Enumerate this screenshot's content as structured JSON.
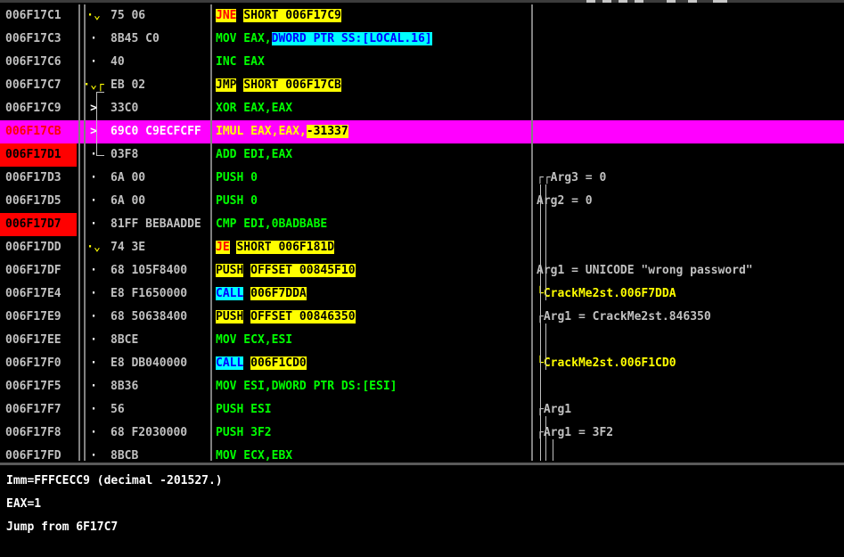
{
  "rows": [
    {
      "addr": "006F17C1",
      "addr_red": false,
      "mark": "·⌄",
      "bytes": "75 06",
      "parts": [
        {
          "t": "JNE",
          "c": "hl-r"
        },
        {
          "t": " "
        },
        {
          "t": "SHORT 006F17C9",
          "c": "hl-y"
        }
      ],
      "comment": []
    },
    {
      "addr": "006F17C3",
      "addr_red": false,
      "mark": "·",
      "bytes": "8B45 C0",
      "parts": [
        {
          "t": "MOV EAX,"
        },
        {
          "t": "DWORD PTR SS:[LOCAL.16]",
          "c": "hl-c"
        }
      ],
      "comment": []
    },
    {
      "addr": "006F17C6",
      "addr_red": false,
      "mark": "·",
      "bytes": "40",
      "parts": [
        {
          "t": "INC EAX"
        }
      ],
      "comment": []
    },
    {
      "addr": "006F17C7",
      "addr_red": false,
      "mark": "·⌄┌",
      "bytes": "EB 02",
      "parts": [
        {
          "t": "JMP",
          "c": "hl-y"
        },
        {
          "t": " "
        },
        {
          "t": "SHORT 006F17CB",
          "c": "hl-y"
        }
      ],
      "comment": []
    },
    {
      "addr": "006F17C9",
      "addr_red": false,
      "mark": ">",
      "bytes": "33C0",
      "parts": [
        {
          "t": "XOR EAX,EAX"
        }
      ],
      "comment": []
    },
    {
      "addr": "006F17CB",
      "addr_red": false,
      "selected": true,
      "mark": ">",
      "bytes": "69C0 C9ECFCFF",
      "parts": [
        {
          "t": "IMUL EAX,EAX,"
        },
        {
          "t": "-31337",
          "c": "hl-yy"
        }
      ],
      "comment": []
    },
    {
      "addr": "006F17D1",
      "addr_red": true,
      "mark": "·",
      "bytes": "03F8",
      "parts": [
        {
          "t": "ADD EDI,EAX"
        }
      ],
      "comment": []
    },
    {
      "addr": "006F17D3",
      "addr_red": false,
      "mark": "·",
      "bytes": "6A 00",
      "parts": [
        {
          "t": "PUSH 0"
        }
      ],
      "comment": [
        {
          "t": "┌┌",
          "c": "w"
        },
        {
          "t": "Arg3 = 0",
          "c": "w"
        }
      ]
    },
    {
      "addr": "006F17D5",
      "addr_red": false,
      "mark": "·",
      "bytes": "6A 00",
      "parts": [
        {
          "t": "PUSH 0"
        }
      ],
      "comment": [
        {
          "t": "  ",
          "c": "w"
        },
        {
          "t": "Arg2 = 0",
          "c": "w"
        }
      ]
    },
    {
      "addr": "006F17D7",
      "addr_red": true,
      "mark": "·",
      "bytes": "81FF BEBAADDE",
      "parts": [
        {
          "t": "CMP EDI,0BADBABE"
        }
      ],
      "comment": []
    },
    {
      "addr": "006F17DD",
      "addr_red": false,
      "mark": "·⌄",
      "bytes": "74 3E",
      "parts": [
        {
          "t": "JE",
          "c": "hl-r"
        },
        {
          "t": " "
        },
        {
          "t": "SHORT 006F181D",
          "c": "hl-y"
        }
      ],
      "comment": []
    },
    {
      "addr": "006F17DF",
      "addr_red": false,
      "mark": "·",
      "bytes": "68 105F8400",
      "parts": [
        {
          "t": "PUSH",
          "c": "hl-y"
        },
        {
          "t": " "
        },
        {
          "t": "OFFSET 00845F10",
          "c": "hl-y"
        }
      ],
      "comment": [
        {
          "t": "  ",
          "c": "w"
        },
        {
          "t": "Arg1 = UNICODE \"wrong password\"",
          "c": "w"
        }
      ]
    },
    {
      "addr": "006F17E4",
      "addr_red": false,
      "mark": "·",
      "bytes": "E8 F1650000",
      "parts": [
        {
          "t": "CALL",
          "c": "hl-c"
        },
        {
          "t": " "
        },
        {
          "t": "006F7DDA",
          "c": "hl-y"
        }
      ],
      "comment": [
        {
          "t": "└",
          "c": "y"
        },
        {
          "t": "CrackMe2st.006F7DDA",
          "c": "y"
        }
      ]
    },
    {
      "addr": "006F17E9",
      "addr_red": false,
      "mark": "·",
      "bytes": "68 50638400",
      "parts": [
        {
          "t": "PUSH",
          "c": "hl-y"
        },
        {
          "t": " "
        },
        {
          "t": "OFFSET 00846350",
          "c": "hl-y"
        }
      ],
      "comment": [
        {
          "t": "┌",
          "c": "w"
        },
        {
          "t": "Arg1 = CrackMe2st.846350",
          "c": "w"
        }
      ]
    },
    {
      "addr": "006F17EE",
      "addr_red": false,
      "mark": "·",
      "bytes": "8BCE",
      "parts": [
        {
          "t": "MOV ECX,ESI"
        }
      ],
      "comment": []
    },
    {
      "addr": "006F17F0",
      "addr_red": false,
      "mark": "·",
      "bytes": "E8 DB040000",
      "parts": [
        {
          "t": "CALL",
          "c": "hl-c"
        },
        {
          "t": " "
        },
        {
          "t": "006F1CD0",
          "c": "hl-y"
        }
      ],
      "comment": [
        {
          "t": "└",
          "c": "y"
        },
        {
          "t": "CrackMe2st.006F1CD0",
          "c": "y"
        }
      ]
    },
    {
      "addr": "006F17F5",
      "addr_red": false,
      "mark": "·",
      "bytes": "8B36",
      "parts": [
        {
          "t": "MOV ESI,DWORD PTR DS:[ESI]"
        }
      ],
      "comment": []
    },
    {
      "addr": "006F17F7",
      "addr_red": false,
      "mark": "·",
      "bytes": "56",
      "parts": [
        {
          "t": "PUSH ESI"
        }
      ],
      "comment": [
        {
          "t": "┌",
          "c": "w"
        },
        {
          "t": "Arg1",
          "c": "w"
        }
      ]
    },
    {
      "addr": "006F17F8",
      "addr_red": false,
      "mark": "·",
      "bytes": "68 F2030000",
      "parts": [
        {
          "t": "PUSH 3F2"
        }
      ],
      "comment": [
        {
          "t": " ┌",
          "c": "w"
        },
        {
          "t": "Arg1 = 3F2",
          "c": "w"
        }
      ]
    },
    {
      "addr": "006F17FD",
      "addr_red": false,
      "mark": "·",
      "bytes": "8BCB",
      "parts": [
        {
          "t": "MOV ECX,EBX"
        }
      ],
      "comment": []
    }
  ],
  "info": {
    "line1": "Imm=FFFCECC9 (decimal -201527.)",
    "line2": "EAX=1",
    "line3": "Jump from 6F17C7"
  }
}
